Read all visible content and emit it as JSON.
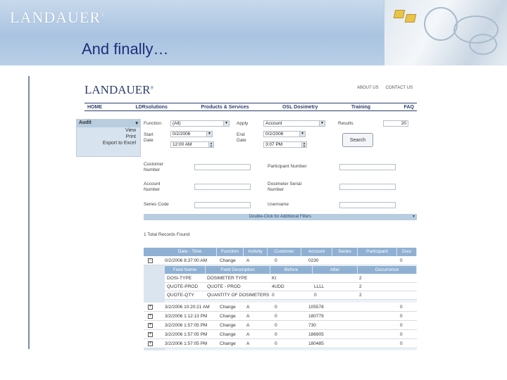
{
  "banner": {
    "logo": "LANDAUER",
    "logo_mark": "®"
  },
  "slide": {
    "title": "And finally…"
  },
  "app": {
    "logo": "LANDAUER",
    "logo_mark": "®",
    "top_links": [
      "ABOUT US",
      "CONTACT US"
    ],
    "nav": [
      "HOME",
      "LDRsolutions",
      "Products & Services",
      "OSL Dosimetry",
      "Training",
      "FAQ"
    ]
  },
  "side": {
    "title": "Audit",
    "items": [
      "View",
      "Print",
      "Export to Excel"
    ]
  },
  "form": {
    "function_label": "Function",
    "function_value": "(All)",
    "apply_label": "Apply",
    "apply_value": "Account",
    "results_label": "Results",
    "results_value": "20",
    "start_label": "Start",
    "start_label2": "Date",
    "start_date": "0/2/2006",
    "start_time": "12:00 AM",
    "end_label": "End",
    "end_label2": "Date",
    "end_date": "0/2/2006",
    "end_time": "3:07 PM",
    "search_button": "Search",
    "customer_label": "Customer",
    "customer_label2": "Number",
    "participant_label": "Participant Number",
    "account_label": "Account",
    "account_label2": "Number",
    "serial_label": "Dosimeter Serial",
    "serial_label2": "Number",
    "series_label": "Series Code",
    "username_label": "Username",
    "filter_bar": "Double-Click for Additional Filters",
    "records_found": "1 Total Records Found"
  },
  "grid": {
    "headers": [
      "Date - Time",
      "Function",
      "Activity",
      "Customer",
      "Account",
      "Series",
      "Participant",
      "Dosi"
    ],
    "first_row": [
      "0/2/2006 8:37:00 AM",
      "Change",
      "A",
      "0",
      "0230",
      "",
      "",
      "0"
    ],
    "sub_headers": [
      "Field Name",
      "Field Description",
      "Before",
      "After",
      "Occurrence"
    ],
    "sub_rows": [
      [
        "DOSI-TYPE",
        "DOSIMETER TYPE",
        "KI",
        "",
        "2"
      ],
      [
        "QUOTE-PROD",
        "QUOTE - PROD",
        "4UDD",
        "LLLL",
        "2"
      ],
      [
        "QUOTE-QTY",
        "QUANTITY OF DOSIMETERS CH",
        "0",
        "0",
        "2"
      ]
    ],
    "rows": [
      [
        "3/2/2006 10:20:21 AM",
        "Change",
        "A",
        "0",
        "105578",
        "0"
      ],
      [
        "3/2/2006 1:12:13 PM",
        "Change",
        "A",
        "0",
        "180779",
        "0"
      ],
      [
        "3/2/2006 1:57:05 PM",
        "Change",
        "A",
        "0",
        "730",
        "0"
      ],
      [
        "3/2/2006 1:57:05 PM",
        "Change",
        "A",
        "0",
        "186905",
        "0"
      ],
      [
        "3/2/2006 1:57:05 PM",
        "Change",
        "A",
        "0",
        "180485",
        "0"
      ]
    ]
  }
}
